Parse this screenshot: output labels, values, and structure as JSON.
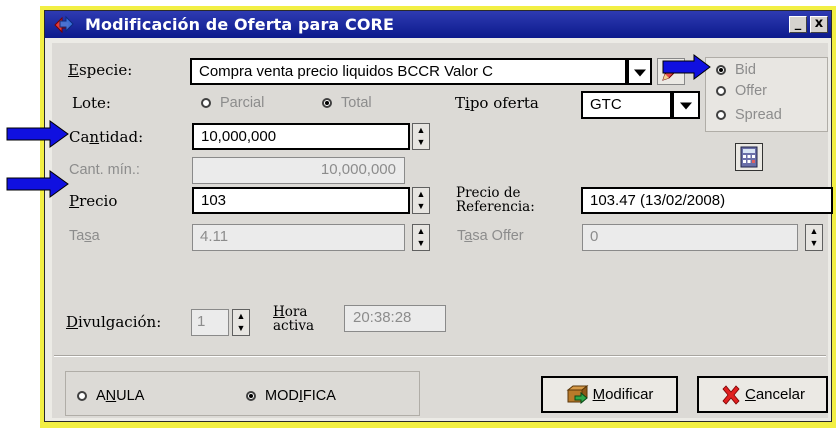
{
  "window": {
    "title": "Modificación de Oferta para CORE",
    "minimize_label": "_",
    "close_label": "x"
  },
  "form": {
    "especie": {
      "label_pre": "",
      "label_u": "E",
      "label_post": "specie:",
      "value": "Compra venta precio liquidos BCCR Valor C"
    },
    "lote": {
      "label": "Lote:",
      "options": [
        "Parcial",
        "Total"
      ],
      "selected": "Total"
    },
    "tipo_oferta": {
      "label_pre": "T",
      "label_u": "i",
      "label_post": "po oferta",
      "value": "GTC"
    },
    "side": {
      "options": [
        "Bid",
        "Offer",
        "Spread"
      ],
      "selected": "Bid"
    },
    "cantidad": {
      "label_pre": "Ca",
      "label_u": "n",
      "label_post": "tidad:",
      "value": "10,000,000"
    },
    "cant_min": {
      "label": "Cant. mín.:",
      "value": "10,000,000"
    },
    "precio": {
      "label_pre": "",
      "label_u": "P",
      "label_post": "recio",
      "value": "103"
    },
    "precio_referencia": {
      "label_line1": "Precio de",
      "label_line2": "Referencia:",
      "value": "103.47 (13/02/2008)"
    },
    "tasa": {
      "label_pre": "Ta",
      "label_u": "s",
      "label_post": "a",
      "value": "4.11"
    },
    "tasa_offer": {
      "label_pre": "T",
      "label_u": "a",
      "label_post": "sa Offer",
      "value": "0"
    },
    "divulgacion": {
      "label_pre": "",
      "label_u": "D",
      "label_post": "ivulgación:",
      "value": "1"
    },
    "hora_activa": {
      "label_line1_u": "H",
      "label_line1_rest": "ora",
      "label_line2": "activa",
      "value": "20:38:28"
    }
  },
  "footer": {
    "action": {
      "options": [
        {
          "pre": "A",
          "u": "N",
          "post": "ULA"
        },
        {
          "pre": "MOD",
          "u": "I",
          "post": "FICA"
        }
      ],
      "selected_index": 1
    },
    "modificar": {
      "label_u": "M",
      "label_rest": "odificar"
    },
    "cancelar": {
      "label_u": "C",
      "label_rest": "ancelar"
    }
  },
  "icons": [
    "title-app-icon",
    "pencil-icon",
    "calculator-icon",
    "modificar-icon",
    "cancel-x-icon",
    "annotation-arrow"
  ],
  "colors": {
    "titlebar": "#0c1a8c",
    "frame_highlight": "#f2ef44",
    "annotation_arrow": "#1010e0",
    "dialog_bg": "#dcdad6"
  }
}
